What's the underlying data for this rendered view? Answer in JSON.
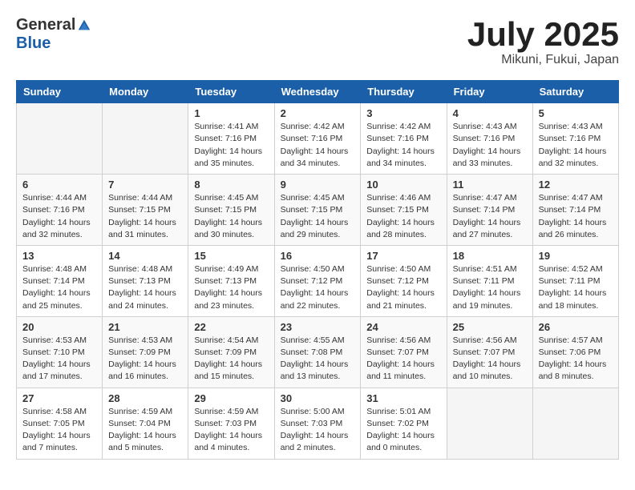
{
  "header": {
    "logo_general": "General",
    "logo_blue": "Blue",
    "month_title": "July 2025",
    "location": "Mikuni, Fukui, Japan"
  },
  "days_of_week": [
    "Sunday",
    "Monday",
    "Tuesday",
    "Wednesday",
    "Thursday",
    "Friday",
    "Saturday"
  ],
  "weeks": [
    [
      {
        "day": "",
        "sunrise": "",
        "sunset": "",
        "daylight": ""
      },
      {
        "day": "",
        "sunrise": "",
        "sunset": "",
        "daylight": ""
      },
      {
        "day": "1",
        "sunrise": "Sunrise: 4:41 AM",
        "sunset": "Sunset: 7:16 PM",
        "daylight": "Daylight: 14 hours and 35 minutes."
      },
      {
        "day": "2",
        "sunrise": "Sunrise: 4:42 AM",
        "sunset": "Sunset: 7:16 PM",
        "daylight": "Daylight: 14 hours and 34 minutes."
      },
      {
        "day": "3",
        "sunrise": "Sunrise: 4:42 AM",
        "sunset": "Sunset: 7:16 PM",
        "daylight": "Daylight: 14 hours and 34 minutes."
      },
      {
        "day": "4",
        "sunrise": "Sunrise: 4:43 AM",
        "sunset": "Sunset: 7:16 PM",
        "daylight": "Daylight: 14 hours and 33 minutes."
      },
      {
        "day": "5",
        "sunrise": "Sunrise: 4:43 AM",
        "sunset": "Sunset: 7:16 PM",
        "daylight": "Daylight: 14 hours and 32 minutes."
      }
    ],
    [
      {
        "day": "6",
        "sunrise": "Sunrise: 4:44 AM",
        "sunset": "Sunset: 7:16 PM",
        "daylight": "Daylight: 14 hours and 32 minutes."
      },
      {
        "day": "7",
        "sunrise": "Sunrise: 4:44 AM",
        "sunset": "Sunset: 7:15 PM",
        "daylight": "Daylight: 14 hours and 31 minutes."
      },
      {
        "day": "8",
        "sunrise": "Sunrise: 4:45 AM",
        "sunset": "Sunset: 7:15 PM",
        "daylight": "Daylight: 14 hours and 30 minutes."
      },
      {
        "day": "9",
        "sunrise": "Sunrise: 4:45 AM",
        "sunset": "Sunset: 7:15 PM",
        "daylight": "Daylight: 14 hours and 29 minutes."
      },
      {
        "day": "10",
        "sunrise": "Sunrise: 4:46 AM",
        "sunset": "Sunset: 7:15 PM",
        "daylight": "Daylight: 14 hours and 28 minutes."
      },
      {
        "day": "11",
        "sunrise": "Sunrise: 4:47 AM",
        "sunset": "Sunset: 7:14 PM",
        "daylight": "Daylight: 14 hours and 27 minutes."
      },
      {
        "day": "12",
        "sunrise": "Sunrise: 4:47 AM",
        "sunset": "Sunset: 7:14 PM",
        "daylight": "Daylight: 14 hours and 26 minutes."
      }
    ],
    [
      {
        "day": "13",
        "sunrise": "Sunrise: 4:48 AM",
        "sunset": "Sunset: 7:14 PM",
        "daylight": "Daylight: 14 hours and 25 minutes."
      },
      {
        "day": "14",
        "sunrise": "Sunrise: 4:48 AM",
        "sunset": "Sunset: 7:13 PM",
        "daylight": "Daylight: 14 hours and 24 minutes."
      },
      {
        "day": "15",
        "sunrise": "Sunrise: 4:49 AM",
        "sunset": "Sunset: 7:13 PM",
        "daylight": "Daylight: 14 hours and 23 minutes."
      },
      {
        "day": "16",
        "sunrise": "Sunrise: 4:50 AM",
        "sunset": "Sunset: 7:12 PM",
        "daylight": "Daylight: 14 hours and 22 minutes."
      },
      {
        "day": "17",
        "sunrise": "Sunrise: 4:50 AM",
        "sunset": "Sunset: 7:12 PM",
        "daylight": "Daylight: 14 hours and 21 minutes."
      },
      {
        "day": "18",
        "sunrise": "Sunrise: 4:51 AM",
        "sunset": "Sunset: 7:11 PM",
        "daylight": "Daylight: 14 hours and 19 minutes."
      },
      {
        "day": "19",
        "sunrise": "Sunrise: 4:52 AM",
        "sunset": "Sunset: 7:11 PM",
        "daylight": "Daylight: 14 hours and 18 minutes."
      }
    ],
    [
      {
        "day": "20",
        "sunrise": "Sunrise: 4:53 AM",
        "sunset": "Sunset: 7:10 PM",
        "daylight": "Daylight: 14 hours and 17 minutes."
      },
      {
        "day": "21",
        "sunrise": "Sunrise: 4:53 AM",
        "sunset": "Sunset: 7:09 PM",
        "daylight": "Daylight: 14 hours and 16 minutes."
      },
      {
        "day": "22",
        "sunrise": "Sunrise: 4:54 AM",
        "sunset": "Sunset: 7:09 PM",
        "daylight": "Daylight: 14 hours and 15 minutes."
      },
      {
        "day": "23",
        "sunrise": "Sunrise: 4:55 AM",
        "sunset": "Sunset: 7:08 PM",
        "daylight": "Daylight: 14 hours and 13 minutes."
      },
      {
        "day": "24",
        "sunrise": "Sunrise: 4:56 AM",
        "sunset": "Sunset: 7:07 PM",
        "daylight": "Daylight: 14 hours and 11 minutes."
      },
      {
        "day": "25",
        "sunrise": "Sunrise: 4:56 AM",
        "sunset": "Sunset: 7:07 PM",
        "daylight": "Daylight: 14 hours and 10 minutes."
      },
      {
        "day": "26",
        "sunrise": "Sunrise: 4:57 AM",
        "sunset": "Sunset: 7:06 PM",
        "daylight": "Daylight: 14 hours and 8 minutes."
      }
    ],
    [
      {
        "day": "27",
        "sunrise": "Sunrise: 4:58 AM",
        "sunset": "Sunset: 7:05 PM",
        "daylight": "Daylight: 14 hours and 7 minutes."
      },
      {
        "day": "28",
        "sunrise": "Sunrise: 4:59 AM",
        "sunset": "Sunset: 7:04 PM",
        "daylight": "Daylight: 14 hours and 5 minutes."
      },
      {
        "day": "29",
        "sunrise": "Sunrise: 4:59 AM",
        "sunset": "Sunset: 7:03 PM",
        "daylight": "Daylight: 14 hours and 4 minutes."
      },
      {
        "day": "30",
        "sunrise": "Sunrise: 5:00 AM",
        "sunset": "Sunset: 7:03 PM",
        "daylight": "Daylight: 14 hours and 2 minutes."
      },
      {
        "day": "31",
        "sunrise": "Sunrise: 5:01 AM",
        "sunset": "Sunset: 7:02 PM",
        "daylight": "Daylight: 14 hours and 0 minutes."
      },
      {
        "day": "",
        "sunrise": "",
        "sunset": "",
        "daylight": ""
      },
      {
        "day": "",
        "sunrise": "",
        "sunset": "",
        "daylight": ""
      }
    ]
  ]
}
